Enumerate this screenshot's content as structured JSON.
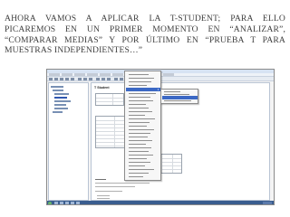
{
  "slide": {
    "heading": "AHORA VAMOS A APLICAR LA T-STUDENT; PARA ELLO PICAREMOS EN UN PRIMER MOMENTO EN “ANALIZAR”, “COMPARAR MEDIAS” Y POR ÚLTIMO EN “PRUEBA T PARA MUESTRAS INDEPENDIENTES…”"
  },
  "screenshot": {
    "app": "SPSS Statistics Visor",
    "output_title": "T Student",
    "colors": {
      "highlight": "#3b68c4",
      "taskbar": "#3a5d8f",
      "window_bg": "#f4f4f4"
    },
    "icons": [
      "tree-node-icon",
      "toolbar-icon",
      "submenu-arrow-icon",
      "start-button-icon"
    ]
  }
}
